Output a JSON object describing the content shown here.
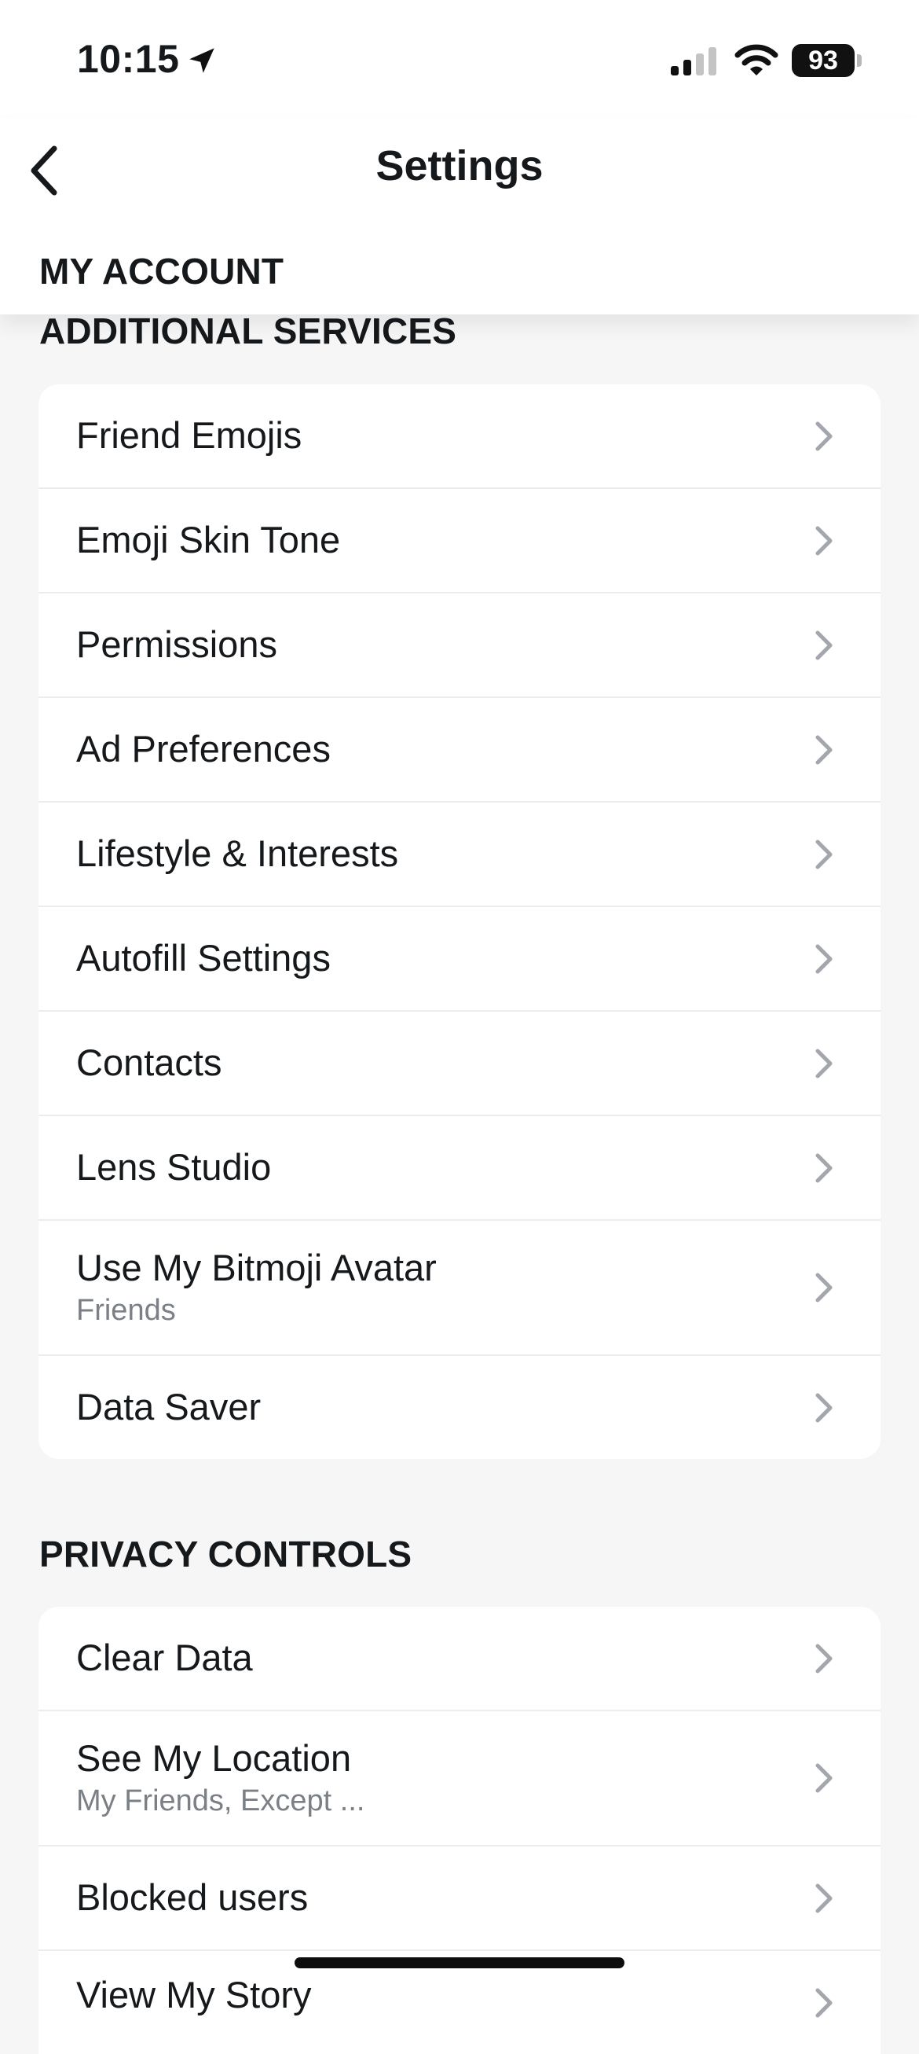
{
  "status_bar": {
    "time": "10:15",
    "battery": "93"
  },
  "nav": {
    "title": "Settings",
    "sticky_section": "MY ACCOUNT"
  },
  "sections": {
    "additional_services": {
      "heading": "ADDITIONAL SERVICES",
      "items": [
        {
          "label": "Friend Emojis"
        },
        {
          "label": "Emoji Skin Tone"
        },
        {
          "label": "Permissions"
        },
        {
          "label": "Ad Preferences"
        },
        {
          "label": "Lifestyle & Interests"
        },
        {
          "label": "Autofill Settings"
        },
        {
          "label": "Contacts"
        },
        {
          "label": "Lens Studio"
        },
        {
          "label": "Use My Bitmoji Avatar",
          "sub": "Friends"
        },
        {
          "label": "Data Saver"
        }
      ]
    },
    "privacy_controls": {
      "heading": "PRIVACY CONTROLS",
      "items": [
        {
          "label": "Clear Data"
        },
        {
          "label": "See My Location",
          "sub": "My Friends, Except ..."
        },
        {
          "label": "Blocked users"
        },
        {
          "label": "View My Story"
        }
      ]
    }
  },
  "colors": {
    "background": "#f6f6f7",
    "card": "#ffffff",
    "text": "#16191c",
    "subtext": "#7b8087",
    "chevron": "#a3a7ad"
  }
}
